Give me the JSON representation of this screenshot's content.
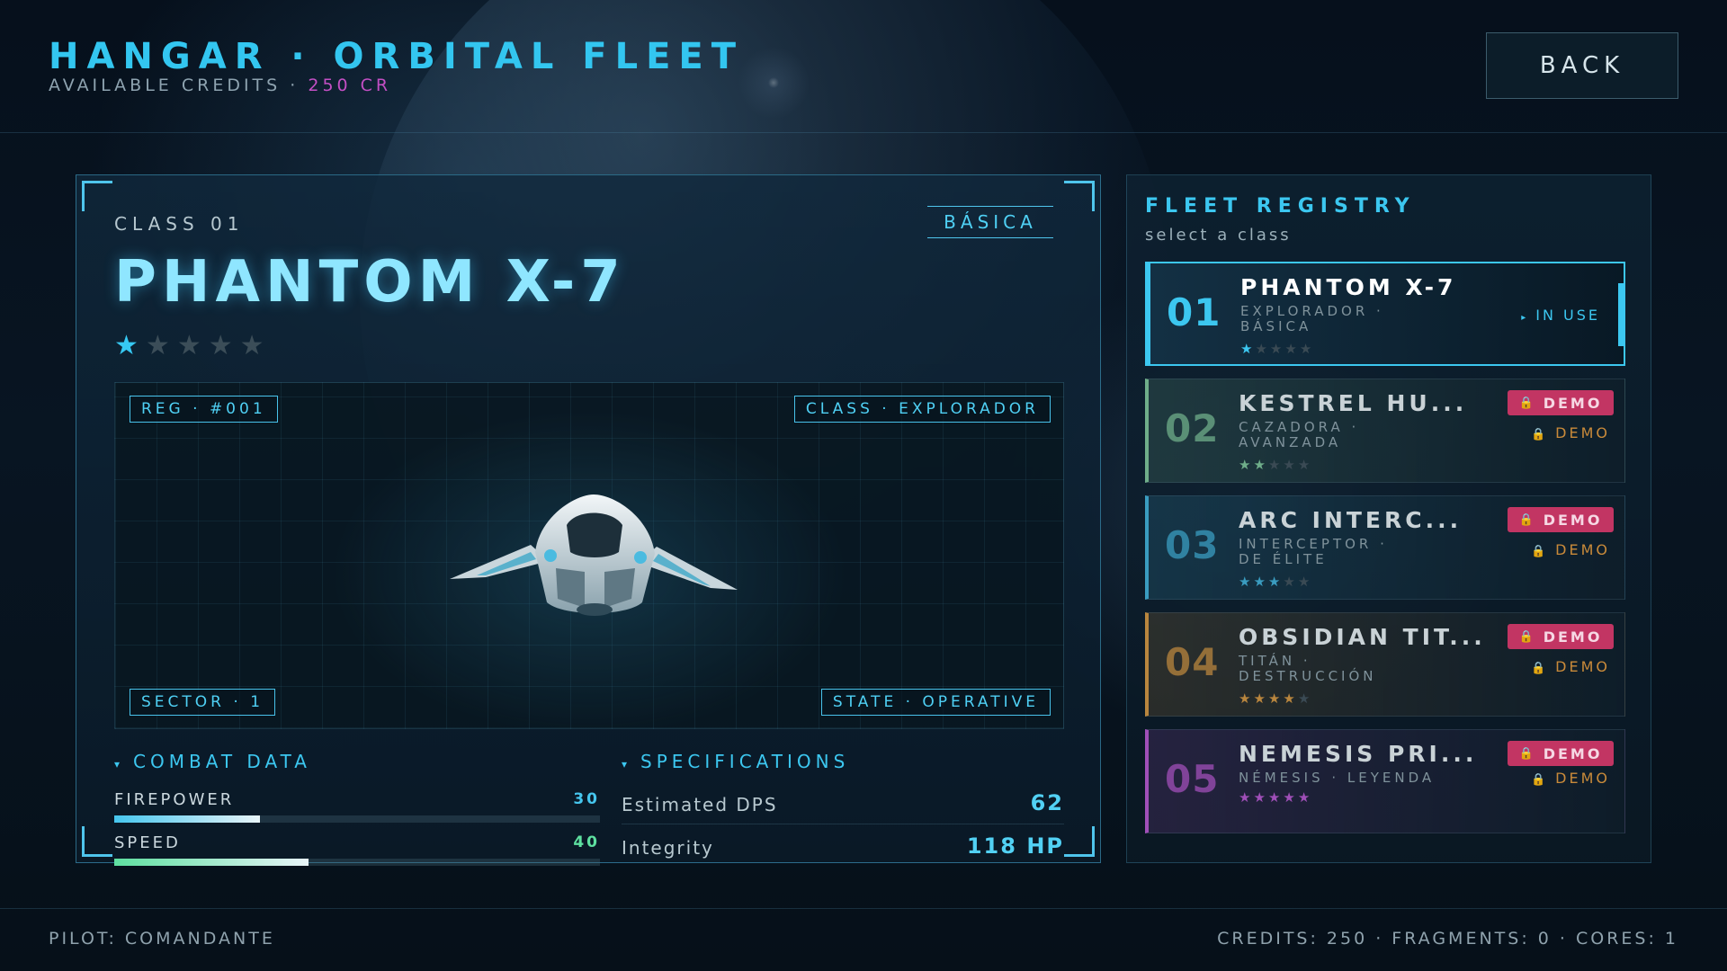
{
  "header": {
    "title": "HANGAR · ORBITAL FLEET",
    "credits_label": "AVAILABLE CREDITS ·",
    "credits_value": "250 CR",
    "back_label": "BACK"
  },
  "ship": {
    "class_label": "CLASS 01",
    "tier": "BÁSICA",
    "name": "PHANTOM X-7",
    "rating": 1,
    "rating_max": 5,
    "tags": {
      "reg": "REG · #001",
      "class": "CLASS · EXPLORADOR",
      "sector": "SECTOR · 1",
      "state": "STATE · OPERATIVE"
    }
  },
  "combat": {
    "heading": "COMBAT DATA",
    "stats": [
      {
        "label": "FIREPOWER",
        "value": "30",
        "fraction": 0.3,
        "color": "#46c6ee"
      },
      {
        "label": "SPEED",
        "value": "40",
        "fraction": 0.4,
        "color": "#5ee0a0"
      }
    ]
  },
  "specs": {
    "heading": "SPECIFICATIONS",
    "rows": [
      {
        "label": "Estimated DPS",
        "value": "62"
      },
      {
        "label": "Integrity",
        "value": "118 HP"
      }
    ]
  },
  "registry": {
    "title": "FLEET REGISTRY",
    "subtitle": "select a class",
    "in_use_label": "IN USE",
    "demo_label": "DEMO",
    "slots": [
      {
        "num": "01",
        "name": "PHANTOM X-7",
        "sub": "EXPLORADOR · BÁSICA",
        "stars": 1,
        "accent": "#3cc7f0",
        "active": true
      },
      {
        "num": "02",
        "name": "KESTREL HU...",
        "sub": "CAZADORA · AVANZADA",
        "stars": 2,
        "accent": "#6fae8a",
        "active": false
      },
      {
        "num": "03",
        "name": "ARC INTERC...",
        "sub": "INTERCEPTOR · DE ÉLITE",
        "stars": 3,
        "accent": "#3a9cc0",
        "active": false
      },
      {
        "num": "04",
        "name": "OBSIDIAN TIT...",
        "sub": "TITÁN · DESTRUCCIÓN",
        "stars": 4,
        "accent": "#b9863e",
        "active": false
      },
      {
        "num": "05",
        "name": "NEMESIS PRI...",
        "sub": "NÉMESIS · LEYENDA",
        "stars": 5,
        "accent": "#a04fb8",
        "active": false
      }
    ]
  },
  "footer": {
    "pilot": "PILOT: COMANDANTE",
    "resources": "CREDITS: 250 · FRAGMENTS: 0 · CORES: 1"
  }
}
